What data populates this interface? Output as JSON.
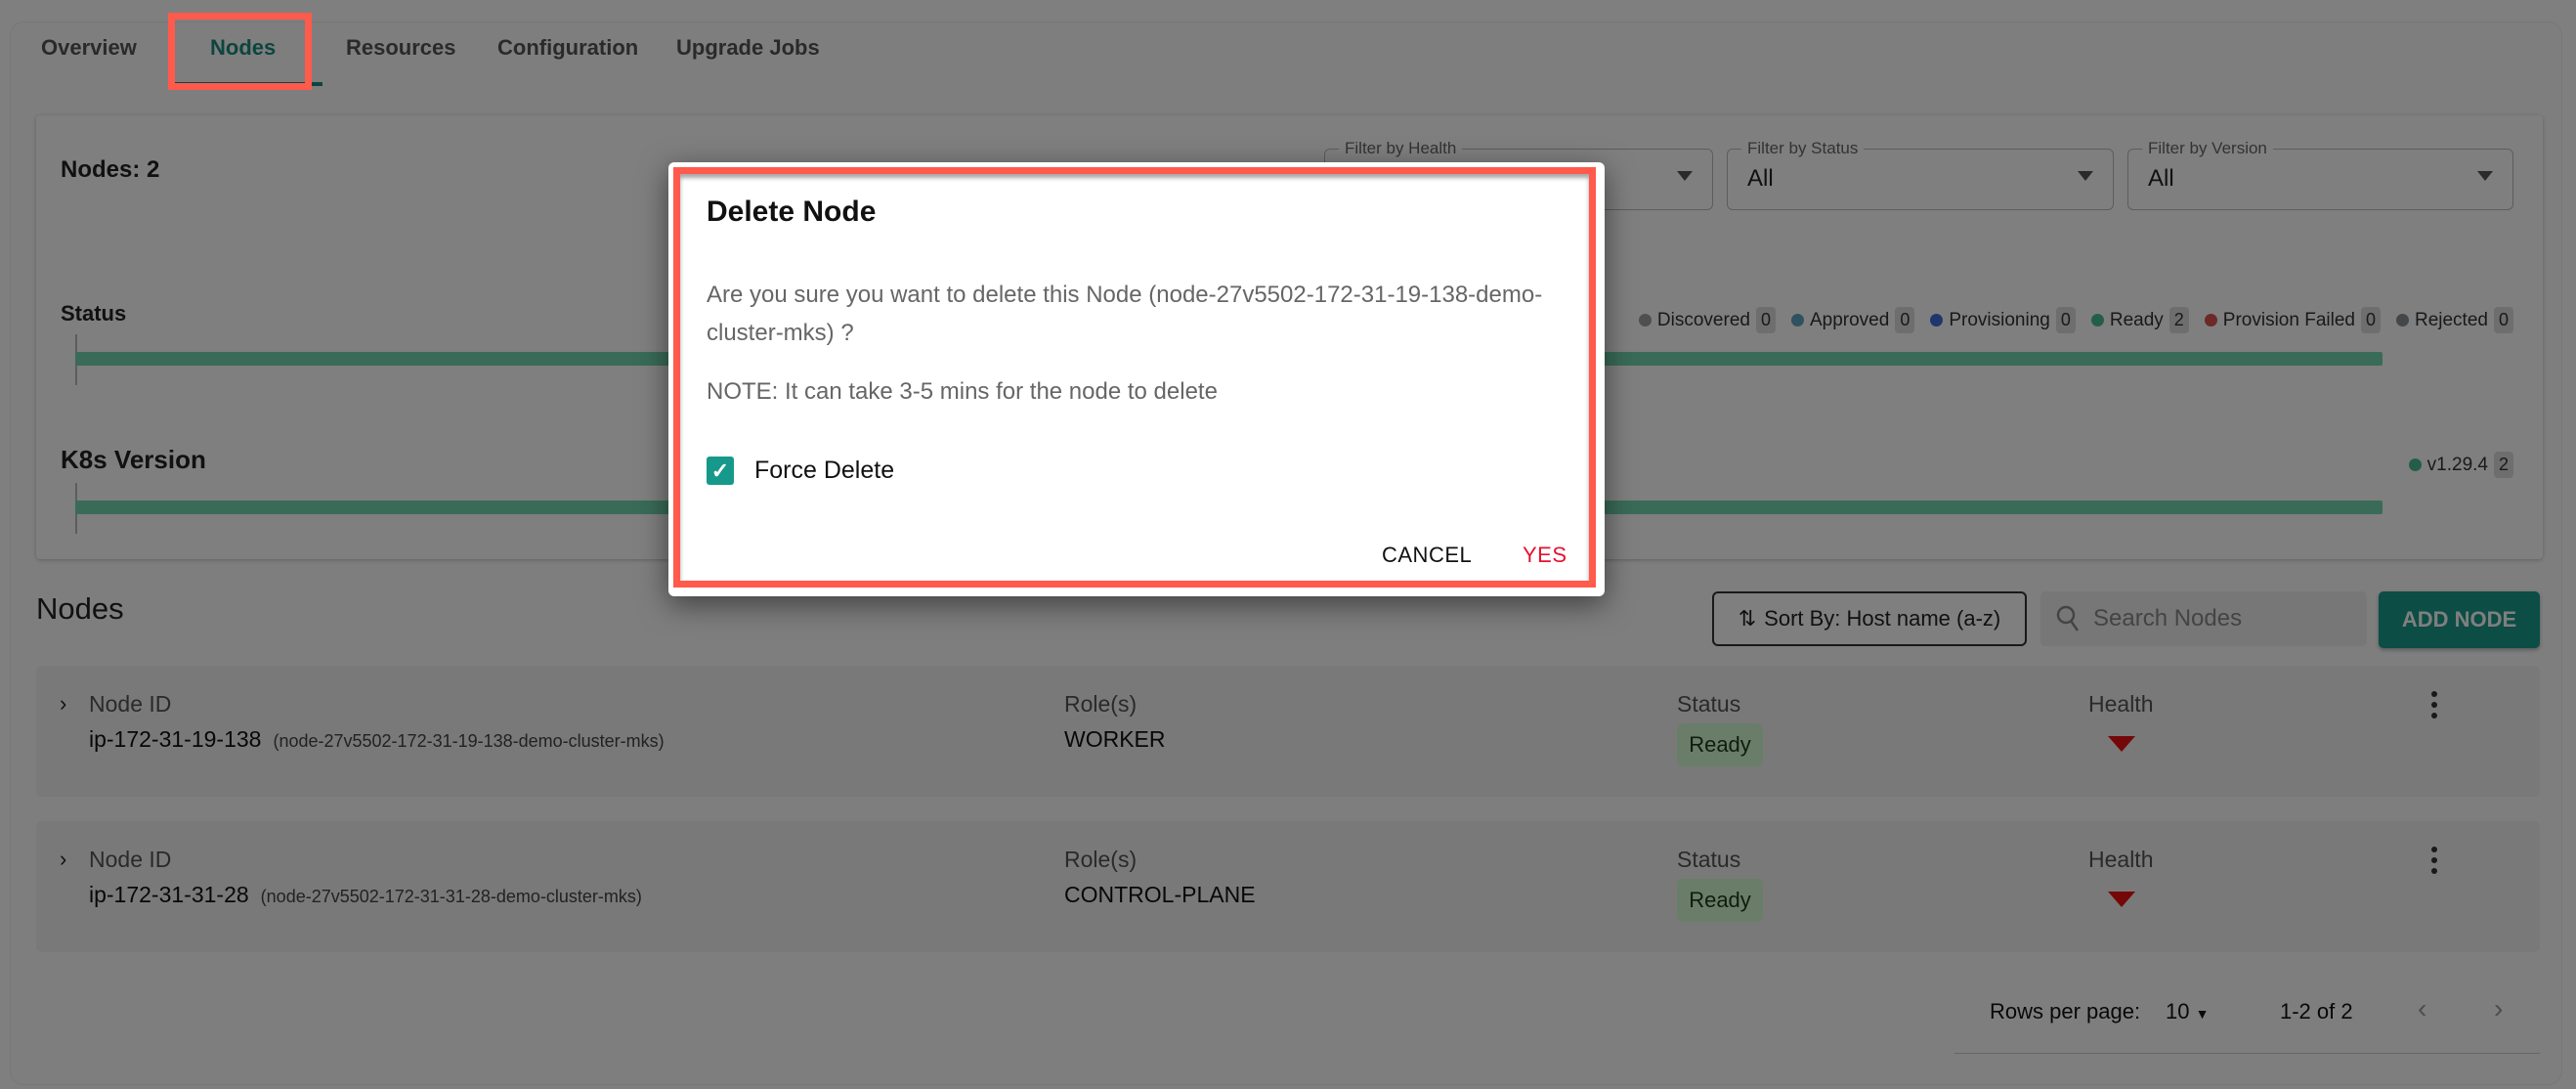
{
  "tabs": [
    {
      "label": "Overview"
    },
    {
      "label": "Nodes",
      "active": true
    },
    {
      "label": "Resources"
    },
    {
      "label": "Configuration"
    },
    {
      "label": "Upgrade Jobs"
    }
  ],
  "summary": {
    "nodes_count": "Nodes: 2",
    "filters": [
      {
        "label": "Filter by Health",
        "value": ""
      },
      {
        "label": "Filter by Status",
        "value": "All"
      },
      {
        "label": "Filter by Version",
        "value": "All"
      }
    ],
    "status": {
      "title": "Status",
      "ready_fraction": 1.0,
      "legend": [
        {
          "label": "Discovered",
          "count": "0",
          "color": "#9e9e9e"
        },
        {
          "label": "Approved",
          "count": "0",
          "color": "#5ea3c0"
        },
        {
          "label": "Provisioning",
          "count": "0",
          "color": "#3f6fd8"
        },
        {
          "label": "Ready",
          "count": "2",
          "color": "#4bbd8c"
        },
        {
          "label": "Provision Failed",
          "count": "0",
          "color": "#d9534f"
        },
        {
          "label": "Rejected",
          "count": "0",
          "color": "#888e94"
        }
      ]
    },
    "version": {
      "title": "K8s Version",
      "fraction": 1.0,
      "legend": [
        {
          "label": "v1.29.4",
          "count": "2",
          "color": "#4bbd8c"
        }
      ]
    }
  },
  "nodes": {
    "title": "Nodes",
    "sort_label": "Sort By: Host name (a-z)",
    "search_placeholder": "Search Nodes",
    "add_label": "ADD NODE",
    "rows": [
      {
        "id_label": "Node ID",
        "host": "ip-172-31-19-138",
        "node_name": "(node-27v5502-172-31-19-138-demo-cluster-mks)",
        "roles_label": "Role(s)",
        "roles": "WORKER",
        "status_label": "Status",
        "status": "Ready",
        "health_label": "Health"
      },
      {
        "id_label": "Node ID",
        "host": "ip-172-31-31-28",
        "node_name": "(node-27v5502-172-31-31-28-demo-cluster-mks)",
        "roles_label": "Role(s)",
        "roles": "CONTROL-PLANE",
        "status_label": "Status",
        "status": "Ready",
        "health_label": "Health"
      }
    ],
    "pagination": {
      "rows_per_page_label": "Rows per page:",
      "rows_per_page": "10",
      "range": "1-2 of 2"
    }
  },
  "dialog": {
    "title": "Delete Node",
    "message": "Are you sure you want to delete this Node (node-27v5502-172-31-19-138-demo-cluster-mks) ?",
    "note": "NOTE: It can take 3-5 mins for the node to delete",
    "force_delete_label": "Force Delete",
    "force_delete_checked": true,
    "cancel_label": "CANCEL",
    "yes_label": "YES"
  },
  "colors": {
    "accent": "#189a8a",
    "danger": "#e81010",
    "highlight": "#ff5a4b"
  }
}
